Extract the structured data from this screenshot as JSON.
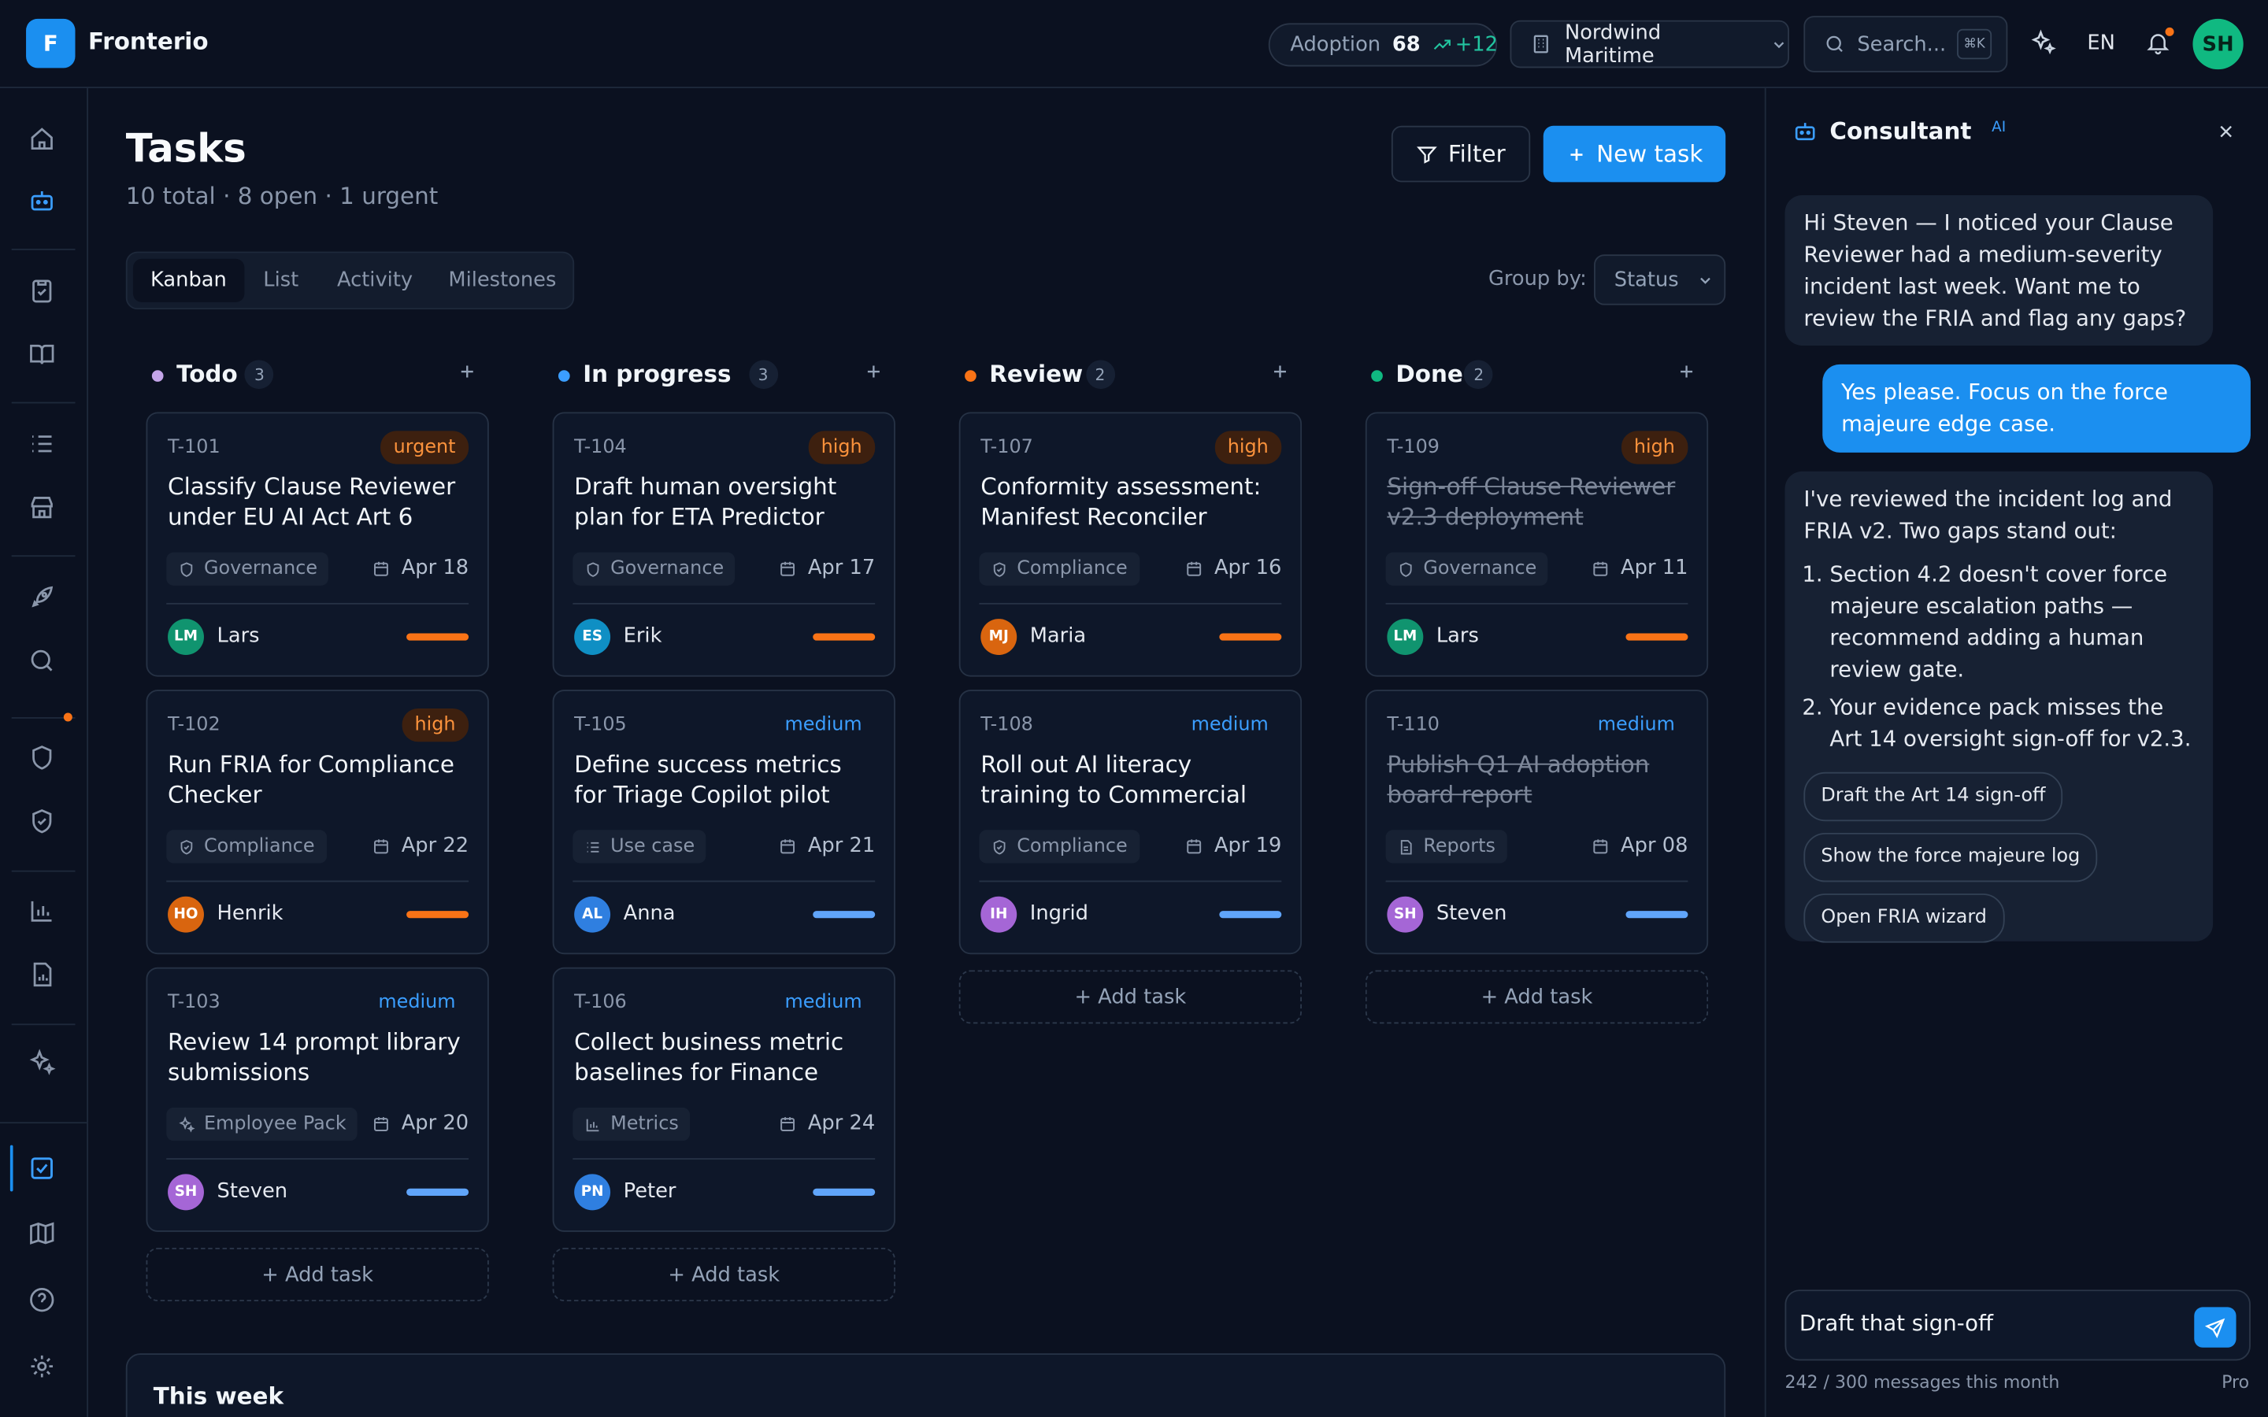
{
  "app": {
    "logo_letter": "F",
    "name": "Fronterio"
  },
  "topbar": {
    "adoption": {
      "label": "Adoption",
      "score": "68",
      "delta": "+12"
    },
    "org": "Nordwind Maritime",
    "search_placeholder": "Search...",
    "search_shortcut": "⌘K",
    "language": "EN",
    "user_initials": "SH"
  },
  "page": {
    "title": "Tasks",
    "subtitle": "10 total · 8 open · 1 urgent",
    "filter_label": "Filter",
    "new_task_label": "New task"
  },
  "view_tabs": [
    "Kanban",
    "List",
    "Activity",
    "Milestones"
  ],
  "active_tab": "Kanban",
  "group_by": {
    "label": "Group by:",
    "value": "Status"
  },
  "add_task_label": "+ Add task",
  "columns": [
    {
      "name": "Todo",
      "count": "3",
      "color": "#c4a5e8",
      "cards": [
        {
          "id": "T-101",
          "priority": "urgent",
          "title": "Classify Clause Reviewer under EU AI Act Art 6",
          "tag": "Governance",
          "tag_icon": "shield-icon",
          "due": "Apr 18",
          "initials": "LM",
          "owner": "Lars",
          "avatar_color": "#10946f",
          "bar": "orange"
        },
        {
          "id": "T-102",
          "priority": "high",
          "title": "Run FRIA for Compliance Checker",
          "tag": "Compliance",
          "tag_icon": "shield-check-icon",
          "due": "Apr 22",
          "initials": "HO",
          "owner": "Henrik",
          "avatar_color": "#d9650f",
          "bar": "orange"
        },
        {
          "id": "T-103",
          "priority": "medium",
          "title": "Review 14 prompt library submissions",
          "tag": "Employee Pack",
          "tag_icon": "sparkles-icon",
          "due": "Apr 20",
          "initials": "SH",
          "owner": "Steven",
          "avatar_color": "#a566d6",
          "bar": "blue"
        }
      ]
    },
    {
      "name": "In progress",
      "count": "3",
      "color": "#3b9eff",
      "cards": [
        {
          "id": "T-104",
          "priority": "high",
          "title": "Draft human oversight plan for ETA Predictor",
          "tag": "Governance",
          "tag_icon": "shield-icon",
          "due": "Apr 17",
          "initials": "ES",
          "owner": "Erik",
          "avatar_color": "#0f8fc4",
          "bar": "orange"
        },
        {
          "id": "T-105",
          "priority": "medium",
          "title": "Define success metrics for Triage Copilot pilot",
          "tag": "Use case",
          "tag_icon": "list-icon",
          "due": "Apr 21",
          "initials": "AL",
          "owner": "Anna",
          "avatar_color": "#2f7fe0",
          "bar": "blue"
        },
        {
          "id": "T-106",
          "priority": "medium",
          "title": "Collect business metric baselines for Finance",
          "tag": "Metrics",
          "tag_icon": "bar-chart-icon",
          "due": "Apr 24",
          "initials": "PN",
          "owner": "Peter",
          "avatar_color": "#2f7fe0",
          "bar": "blue"
        }
      ]
    },
    {
      "name": "Review",
      "count": "2",
      "color": "#f97316",
      "cards": [
        {
          "id": "T-107",
          "priority": "high",
          "title": "Conformity assessment: Manifest Reconciler",
          "tag": "Compliance",
          "tag_icon": "shield-check-icon",
          "due": "Apr 16",
          "initials": "MJ",
          "owner": "Maria",
          "avatar_color": "#d9650f",
          "bar": "orange"
        },
        {
          "id": "T-108",
          "priority": "medium",
          "title": "Roll out AI literacy training to Commercial",
          "tag": "Compliance",
          "tag_icon": "shield-check-icon",
          "due": "Apr 19",
          "initials": "IH",
          "owner": "Ingrid",
          "avatar_color": "#a566d6",
          "bar": "blue"
        }
      ]
    },
    {
      "name": "Done",
      "count": "2",
      "color": "#10b981",
      "cards": [
        {
          "id": "T-109",
          "priority": "high",
          "title": "Sign-off Clause Reviewer v2.3 deployment",
          "tag": "Governance",
          "tag_icon": "shield-icon",
          "due": "Apr 11",
          "initials": "LM",
          "owner": "Lars",
          "avatar_color": "#10946f",
          "bar": "orange",
          "done": true
        },
        {
          "id": "T-110",
          "priority": "medium",
          "title": "Publish Q1 AI adoption board report",
          "tag": "Reports",
          "tag_icon": "file-icon",
          "due": "Apr 08",
          "initials": "SH",
          "owner": "Steven",
          "avatar_color": "#a566d6",
          "bar": "blue",
          "done": true
        }
      ]
    }
  ],
  "this_week_label": "This week",
  "consultant": {
    "title": "Consultant",
    "badge": "AI",
    "messages": [
      {
        "role": "bot",
        "text": "Hi Steven — I noticed your Clause Reviewer had a medium-severity incident last week. Want me to review the FRIA and flag any gaps?"
      },
      {
        "role": "user",
        "text": "Yes please. Focus on the force majeure edge case."
      },
      {
        "role": "bot",
        "text": "I've reviewed the incident log and FRIA v2. Two gaps stand out:",
        "list": [
          "Section 4.2 doesn't cover force majeure escalation paths — recommend adding a human review gate.",
          "Your evidence pack misses the Art 14 oversight sign-off for v2.3."
        ],
        "suggestions": [
          "Draft the Art 14 sign-off",
          "Show the force majeure log",
          "Open FRIA wizard"
        ]
      }
    ],
    "input_value": "Draft that sign-off",
    "usage": "242 / 300 messages this month",
    "plan": "Pro"
  }
}
